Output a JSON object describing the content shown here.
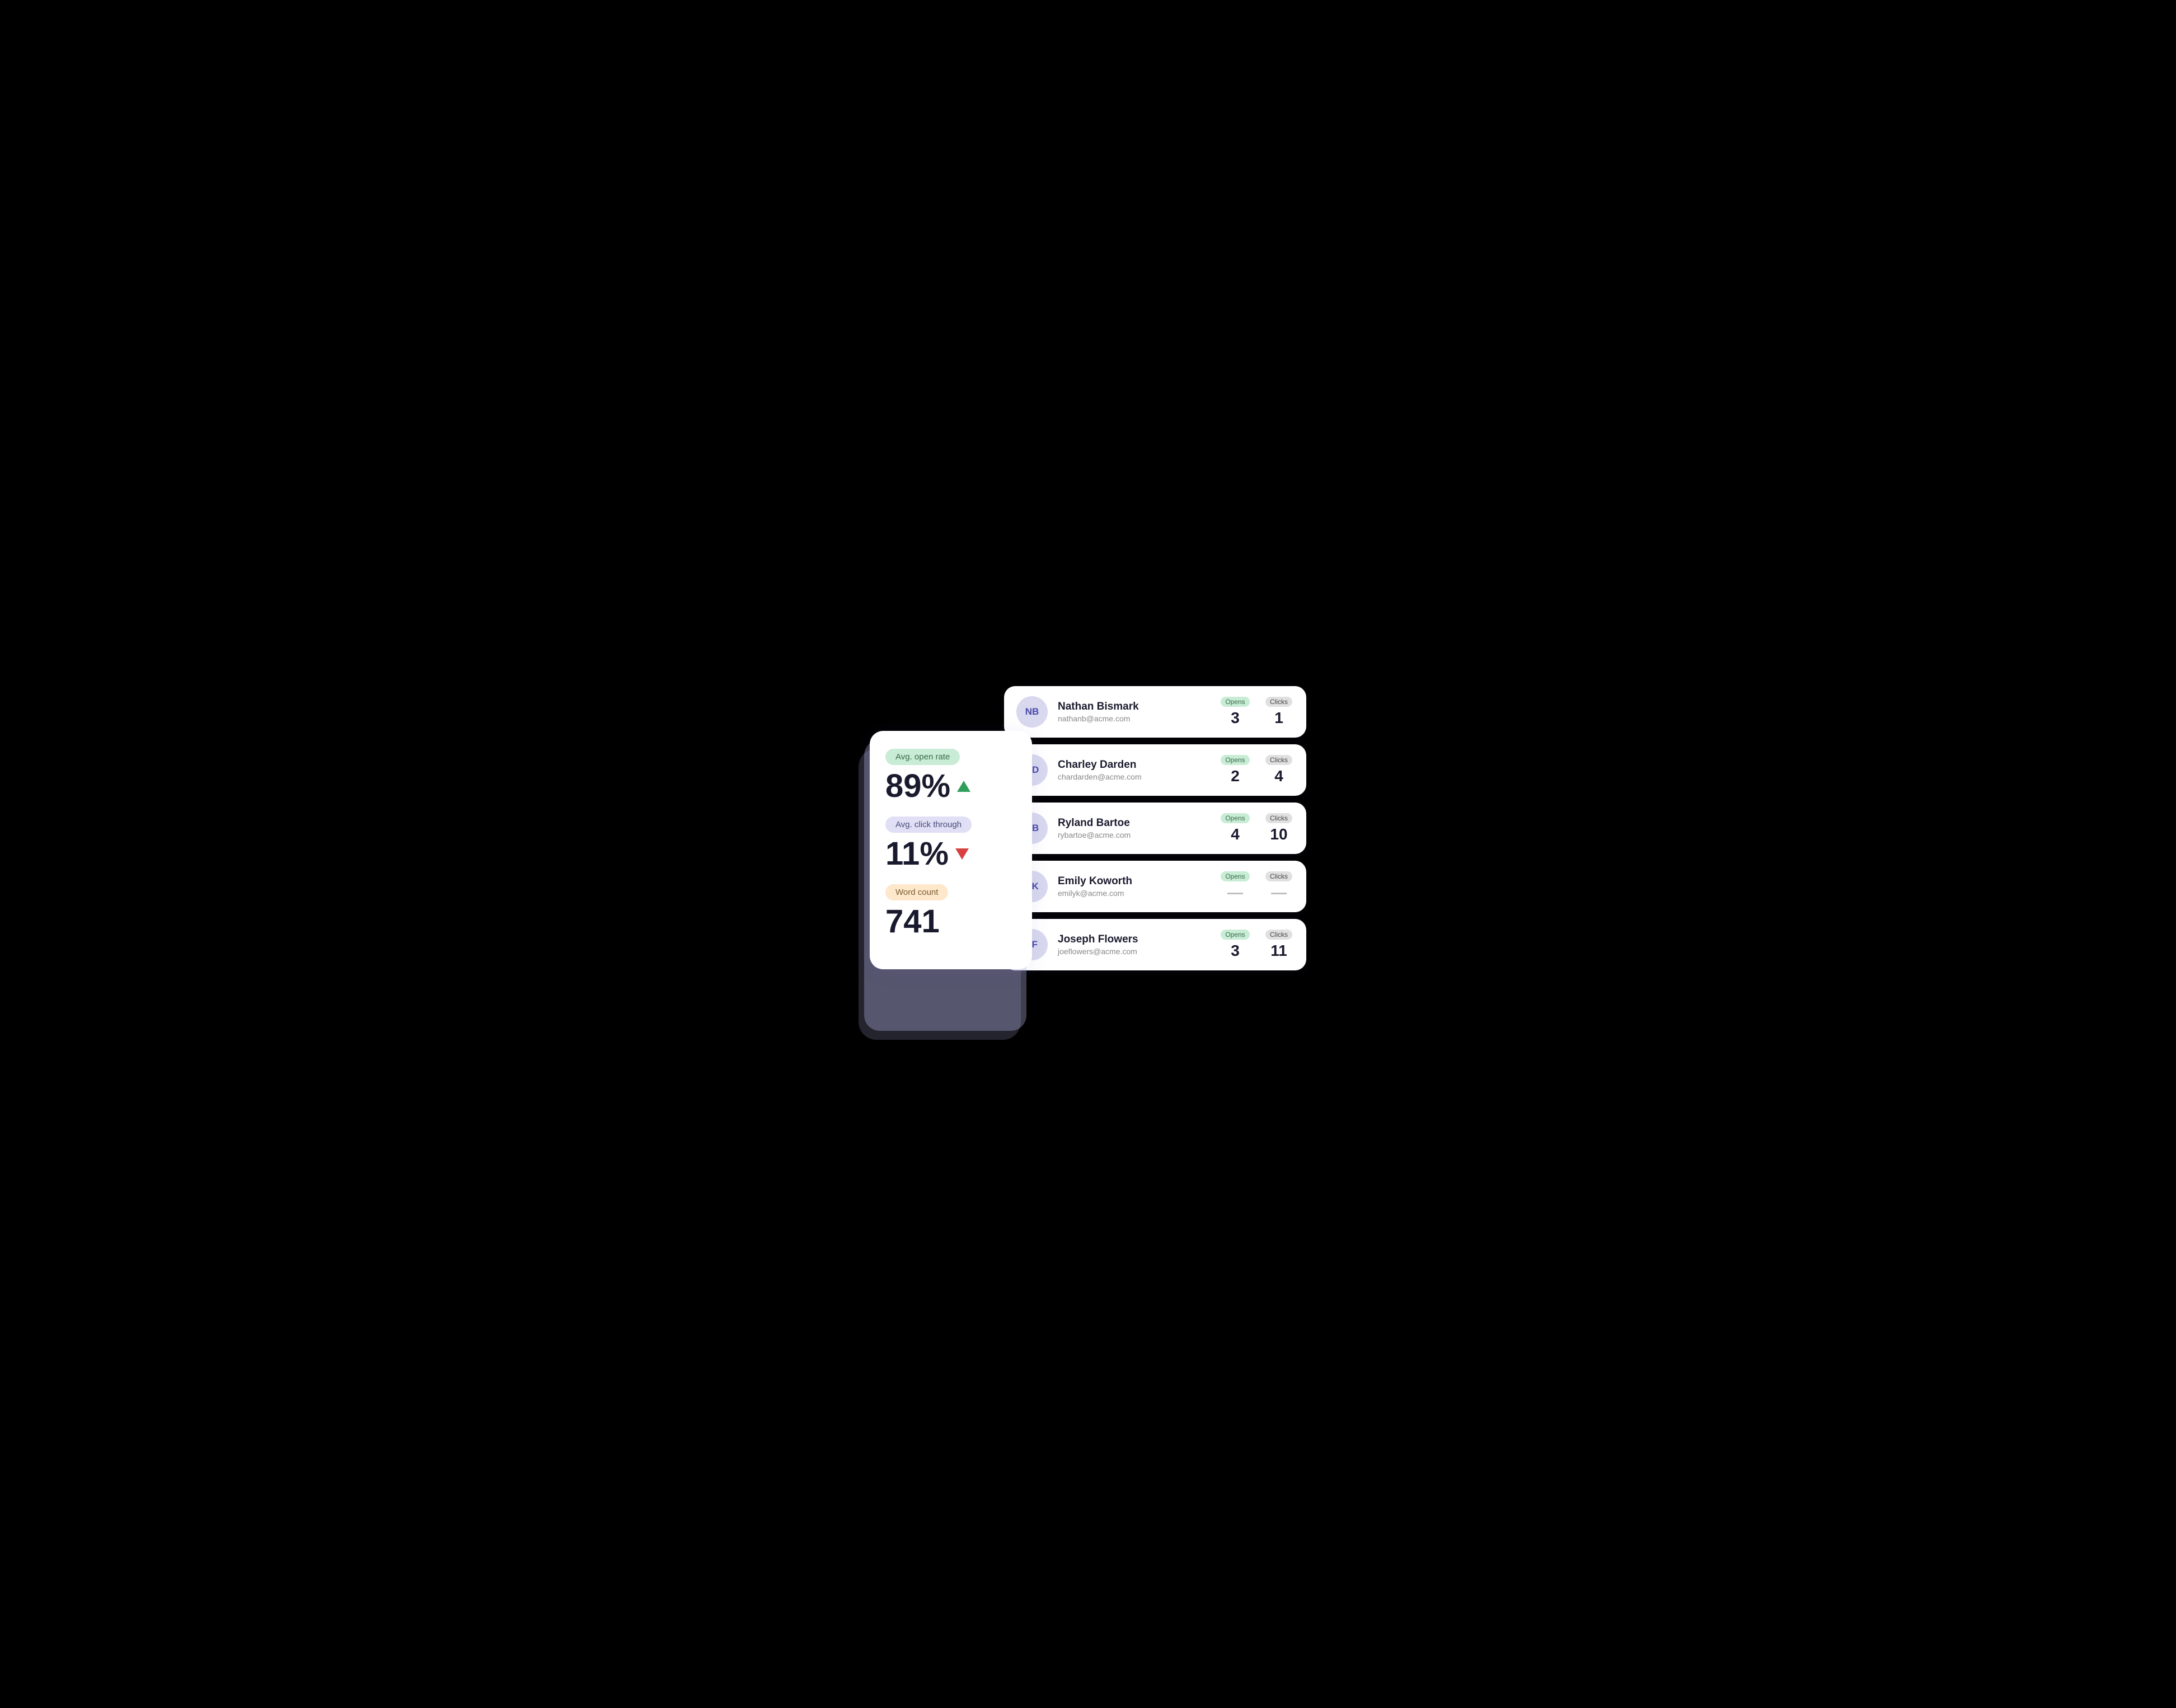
{
  "stats": {
    "avg_open_rate_label": "Avg. open rate",
    "avg_open_rate_value": "89%",
    "avg_open_rate_trend": "up",
    "avg_click_through_label": "Avg. click through",
    "avg_click_through_value": "11%",
    "avg_click_through_trend": "down",
    "word_count_label": "Word count",
    "word_count_value": "741"
  },
  "contacts": [
    {
      "initials": "NB",
      "name": "Nathan Bismark",
      "email": "nathanb@acme.com",
      "opens": "3",
      "clicks": "1",
      "opens_empty": false,
      "clicks_empty": false
    },
    {
      "initials": "CD",
      "name": "Charley Darden",
      "email": "chardarden@acme.com",
      "opens": "2",
      "clicks": "4",
      "opens_empty": false,
      "clicks_empty": false
    },
    {
      "initials": "RB",
      "name": "Ryland Bartoe",
      "email": "rybartoe@acme.com",
      "opens": "4",
      "clicks": "10",
      "opens_empty": false,
      "clicks_empty": false
    },
    {
      "initials": "EK",
      "name": "Emily Koworth",
      "email": "emilyk@acme.com",
      "opens": "—",
      "clicks": "—",
      "opens_empty": true,
      "clicks_empty": true
    },
    {
      "initials": "JF",
      "name": "Joseph Flowers",
      "email": "joeflowers@acme.com",
      "opens": "3",
      "clicks": "11",
      "opens_empty": false,
      "clicks_empty": false
    }
  ],
  "labels": {
    "opens": "Opens",
    "clicks": "Clicks"
  }
}
